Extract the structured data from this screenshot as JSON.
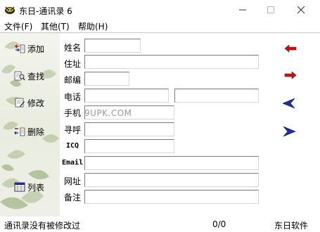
{
  "window": {
    "title": "东日-通讯录 6",
    "minimize_symbol": "—",
    "maximize_symbol": "☐",
    "close_symbol": "✕"
  },
  "menu": [
    {
      "label": "文件(F)"
    },
    {
      "label": "其他(T)"
    },
    {
      "label": "帮助(H)"
    }
  ],
  "sidebar": {
    "buttons": [
      {
        "label": "添加",
        "icon": "add-icon"
      },
      {
        "label": "查找",
        "icon": "find-icon"
      },
      {
        "label": "修改",
        "icon": "edit-icon"
      },
      {
        "label": "删除",
        "icon": "delete-icon"
      },
      {
        "label": "列表",
        "icon": "list-icon"
      }
    ]
  },
  "form": {
    "labels": {
      "name": "姓名",
      "address": "住址",
      "postcode": "邮编",
      "phone": "电话",
      "mobile": "手机",
      "pager": "寻呼",
      "icq": "ICQ",
      "email": "Email",
      "website": "网址",
      "remark": "备注"
    },
    "values": {
      "name": "",
      "address": "",
      "postcode": "",
      "phone1": "",
      "phone2": "",
      "mobile": "",
      "pager": "",
      "icq": "",
      "email": "",
      "website": "",
      "remark": ""
    }
  },
  "navigation": {
    "first_icon": "left-arrow-icon",
    "next_icon": "right-arrow-icon",
    "prev_icon": "back-arrowhead-icon",
    "last_icon": "forward-arrowhead-icon"
  },
  "watermark": "9UPK.COM",
  "status": {
    "message": "通讯录没有被修改过",
    "record_count": "0/0",
    "company": "东日软件"
  },
  "colors": {
    "arrow_red": "#cc1111",
    "arrow_blue": "#1f2f9a",
    "leaf_green": "#7f9a5a"
  }
}
